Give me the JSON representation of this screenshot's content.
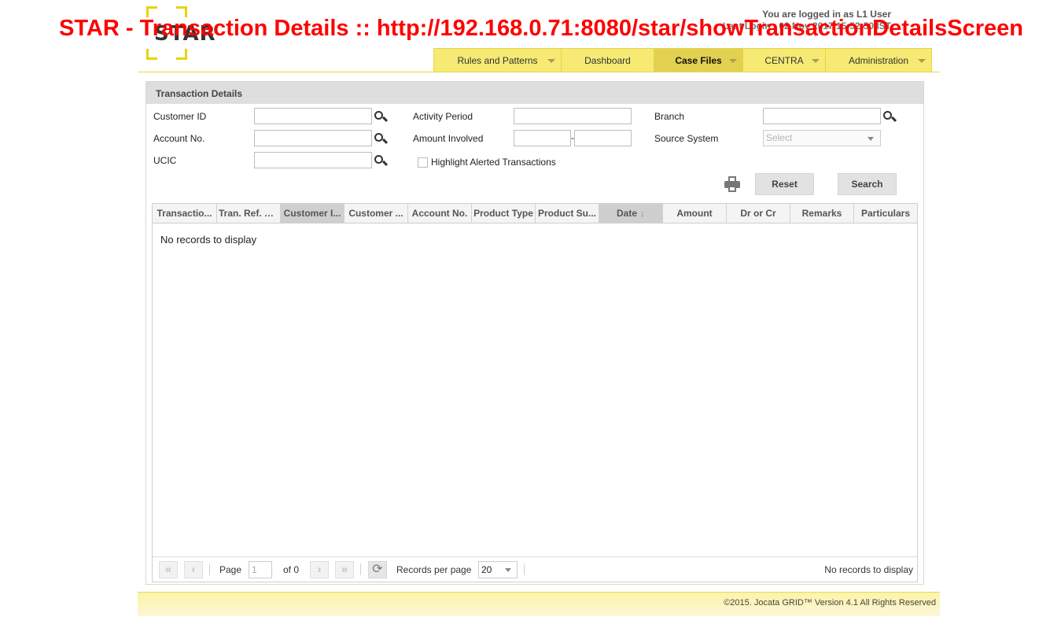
{
  "window_title": "STAR - Transaction Details :: http://192.168.0.71:8080/star/showTransactionDetailsScreen",
  "logo_text": "STAR",
  "user": {
    "logged_in_text": "You are logged in as L1 User",
    "last_login_text": "Last Login : 02 Nov 2017 15:52:50 IST"
  },
  "nav": {
    "items": [
      {
        "label": "Rules and Patterns",
        "has_dropdown": true
      },
      {
        "label": "Dashboard",
        "has_dropdown": false
      },
      {
        "label": "Case Files",
        "has_dropdown": true,
        "active": true
      },
      {
        "label": "CENTRA",
        "has_dropdown": true
      },
      {
        "label": "Administration",
        "has_dropdown": true
      }
    ]
  },
  "panel": {
    "title": "Transaction Details"
  },
  "form": {
    "customer_id_label": "Customer ID",
    "account_no_label": "Account No.",
    "ucic_label": "UCIC",
    "activity_period_label": "Activity Period",
    "amount_involved_label": "Amount Involved",
    "amount_separator": "-",
    "highlight_label": "Highlight Alerted Transactions",
    "branch_label": "Branch",
    "source_system_label": "Source System",
    "source_system_placeholder": "Select",
    "reset_label": "Reset",
    "search_label": "Search"
  },
  "grid": {
    "columns": [
      {
        "label": "Transactio..."
      },
      {
        "label": "Tran. Ref. No."
      },
      {
        "label": "Customer I..."
      },
      {
        "label": "Customer ..."
      },
      {
        "label": "Account No."
      },
      {
        "label": "Product Type"
      },
      {
        "label": "Product Su..."
      },
      {
        "label": "Date",
        "sorted": "desc"
      },
      {
        "label": "Amount"
      },
      {
        "label": "Dr or Cr"
      },
      {
        "label": "Remarks"
      },
      {
        "label": "Particulars"
      }
    ],
    "empty_message": "No records to display"
  },
  "pager": {
    "page_label": "Page",
    "page_value": "1",
    "of_label": "of 0",
    "records_per_page_label": "Records per page",
    "records_per_page_value": "20",
    "status": "No records to display"
  },
  "footer": {
    "text": "©2015. Jocata GRID™ Version 4.1 All Rights Reserved"
  },
  "colors": {
    "nav_bg": "#f6ea74",
    "nav_active": "#e2d050",
    "logo_accent": "#e8d400",
    "overlay_title": "#ff0000"
  }
}
